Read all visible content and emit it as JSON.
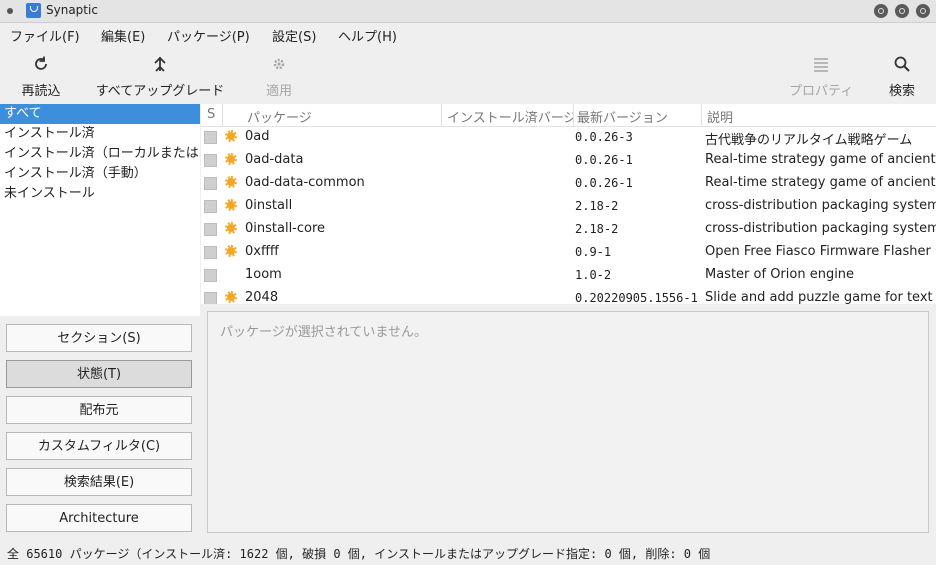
{
  "window": {
    "title": "Synaptic"
  },
  "menubar": [
    "ファイル(F)",
    "編集(E)",
    "パッケージ(P)",
    "設定(S)",
    "ヘルプ(H)"
  ],
  "toolbar": {
    "reload": "再読込",
    "upgrade_all": "すべてアップグレード",
    "apply": "適用",
    "properties": "プロパティ",
    "search": "検索"
  },
  "filters": [
    "すべて",
    "インストール済",
    "インストール済（ローカルまたは",
    "インストール済（手動）",
    "未インストール"
  ],
  "group_buttons": [
    "セクション(S)",
    "状態(T)",
    "配布元",
    "カスタムフィルタ(C)",
    "検索結果(E)",
    "Architecture"
  ],
  "columns": {
    "s": "S",
    "package": "パッケージ",
    "installed": "インストール済バージョン",
    "latest": "最新バージョン",
    "description": "説明"
  },
  "packages": [
    {
      "name": "0ad",
      "latest": "0.0.26-3",
      "description": "古代戦争のリアルタイム戦略ゲーム",
      "supported": true
    },
    {
      "name": "0ad-data",
      "latest": "0.0.26-1",
      "description": "Real-time strategy game of ancient warfare",
      "supported": true
    },
    {
      "name": "0ad-data-common",
      "latest": "0.0.26-1",
      "description": "Real-time strategy game of ancient warfare",
      "supported": true
    },
    {
      "name": "0install",
      "latest": "2.18-2",
      "description": "cross-distribution packaging system",
      "supported": true
    },
    {
      "name": "0install-core",
      "latest": "2.18-2",
      "description": "cross-distribution packaging system",
      "supported": true
    },
    {
      "name": "0xffff",
      "latest": "0.9-1",
      "description": "Open Free Fiasco Firmware Flasher",
      "supported": true
    },
    {
      "name": "1oom",
      "latest": "1.0-2",
      "description": "Master of Orion engine",
      "supported": false
    },
    {
      "name": "2048",
      "latest": "0.20220905.1556-1",
      "description": "Slide and add puzzle game for text mode",
      "supported": true
    }
  ],
  "detail": {
    "message": "パッケージが選択されていません。"
  },
  "status": "全 65610 パッケージ（インストール済: 1622 個, 破損 0 個, インストールまたはアップグレード指定: 0 個, 削除: 0 個"
}
